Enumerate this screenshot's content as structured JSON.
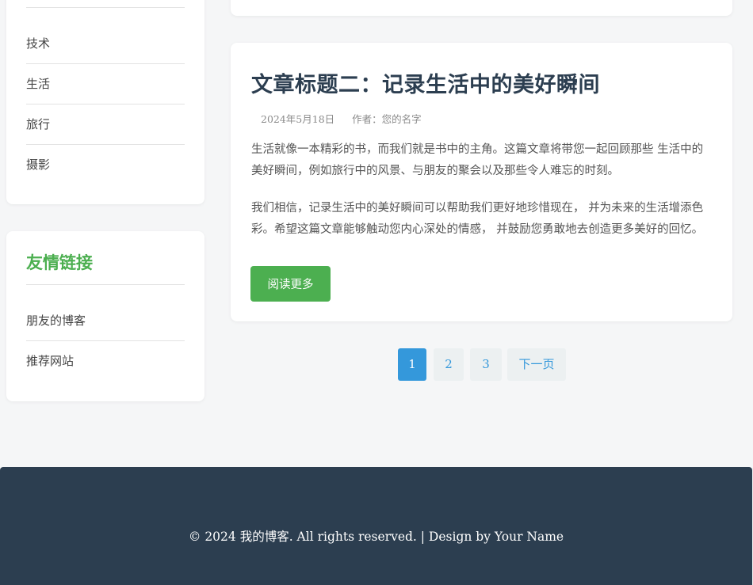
{
  "sidebar": {
    "categories": [
      "技术",
      "生活",
      "旅行",
      "摄影"
    ],
    "links_title": "友情链接",
    "links": [
      "朋友的博客",
      "推荐网站"
    ]
  },
  "article": {
    "title": "文章标题二：记录生活中的美好瞬间",
    "date": "2024年5月18日",
    "author": "作者：您的名字",
    "paragraphs": [
      "生活就像一本精彩的书，而我们就是书中的主角。这篇文章将带您一起回顾那些 生活中的美好瞬间，例如旅行中的风景、与朋友的聚会以及那些令人难忘的时刻。",
      "我们相信，记录生活中的美好瞬间可以帮助我们更好地珍惜现在， 并为未来的生活增添色彩。希望这篇文章能够触动您内心深处的情感， 并鼓励您勇敢地去创造更多美好的回忆。"
    ],
    "read_more": "阅读更多"
  },
  "pagination": {
    "pages": [
      "1",
      "2",
      "3"
    ],
    "next": "下一页",
    "current": 1
  },
  "footer": {
    "text": "© 2024 我的博客. All rights reserved. | Design by Your Name"
  },
  "colors": {
    "accent_green": "#4caf50",
    "accent_blue": "#3498db",
    "footer_bg": "#2c3e50"
  }
}
